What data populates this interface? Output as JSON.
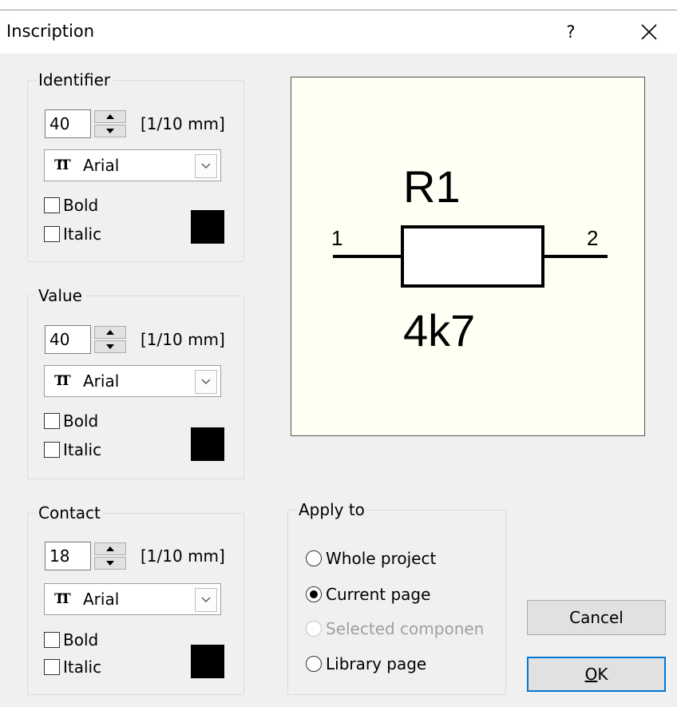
{
  "window": {
    "title": "Inscription",
    "help_label": "?"
  },
  "identifier": {
    "legend": "Identifier",
    "size_value": "40",
    "unit": "[1/10 mm]",
    "font": "Arial",
    "bold_label": "Bold",
    "bold_checked": false,
    "italic_label": "Italic",
    "italic_checked": false,
    "color": "#000000"
  },
  "value": {
    "legend": "Value",
    "size_value": "40",
    "unit": "[1/10 mm]",
    "font": "Arial",
    "bold_label": "Bold",
    "bold_checked": false,
    "italic_label": "Italic",
    "italic_checked": false,
    "color": "#000000"
  },
  "contact": {
    "legend": "Contact",
    "size_value": "18",
    "unit": "[1/10 mm]",
    "font": "Arial",
    "bold_label": "Bold",
    "bold_checked": false,
    "italic_label": "Italic",
    "italic_checked": false,
    "color": "#000000"
  },
  "preview": {
    "identifier": "R1",
    "value": "4k7",
    "pin1": "1",
    "pin2": "2",
    "background": "#fffff3"
  },
  "apply_to": {
    "legend": "Apply to",
    "options": [
      {
        "label": "Whole project",
        "selected": false,
        "enabled": true
      },
      {
        "label": "Current page",
        "selected": true,
        "enabled": true
      },
      {
        "label": "Selected componen",
        "selected": false,
        "enabled": false
      },
      {
        "label": "Library page",
        "selected": false,
        "enabled": true
      }
    ]
  },
  "buttons": {
    "cancel": "Cancel",
    "ok_underlined": "O",
    "ok_rest": "K"
  },
  "icons": {
    "close": "close-icon",
    "font": "truetype-font-icon",
    "spin_up": "spin-up-icon",
    "spin_down": "spin-down-icon",
    "chevron": "chevron-down-icon"
  },
  "colors": {
    "accent": "#0078d7",
    "dialog_bg": "#f0f0f0"
  }
}
